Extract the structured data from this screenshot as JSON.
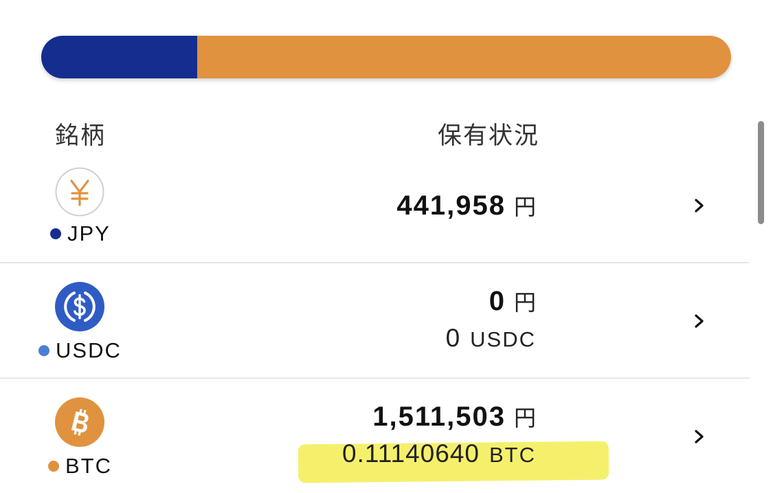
{
  "allocation_bar": {
    "segments": [
      {
        "name": "JPY",
        "fraction": 0.226,
        "color": "#152d8f"
      },
      {
        "name": "BTC",
        "fraction": 0.774,
        "color": "#e0923f"
      }
    ]
  },
  "table_header": {
    "symbol_label": "銘柄",
    "holdings_label": "保有状況"
  },
  "assets": [
    {
      "symbol": "JPY",
      "dot_color": "#152d8f",
      "icon": "yen-icon",
      "jpy_value": "441,958",
      "jpy_unit": "円",
      "quantity": "",
      "quantity_unit": ""
    },
    {
      "symbol": "USDC",
      "dot_color": "#4a7fd4",
      "icon": "usdc-icon",
      "jpy_value": "0",
      "jpy_unit": "円",
      "quantity": "0",
      "quantity_unit": "USDC"
    },
    {
      "symbol": "BTC",
      "dot_color": "#e0923f",
      "icon": "bitcoin-icon",
      "jpy_value": "1,511,503",
      "jpy_unit": "円",
      "quantity": "0.11140640",
      "quantity_unit": "BTC"
    }
  ],
  "colors": {
    "highlight": "#f5f06c",
    "divider": "#e6e6e6",
    "usdc_blue": "#2f5cc4",
    "btc_orange": "#e0923f",
    "yen_orange": "#e0923f"
  }
}
